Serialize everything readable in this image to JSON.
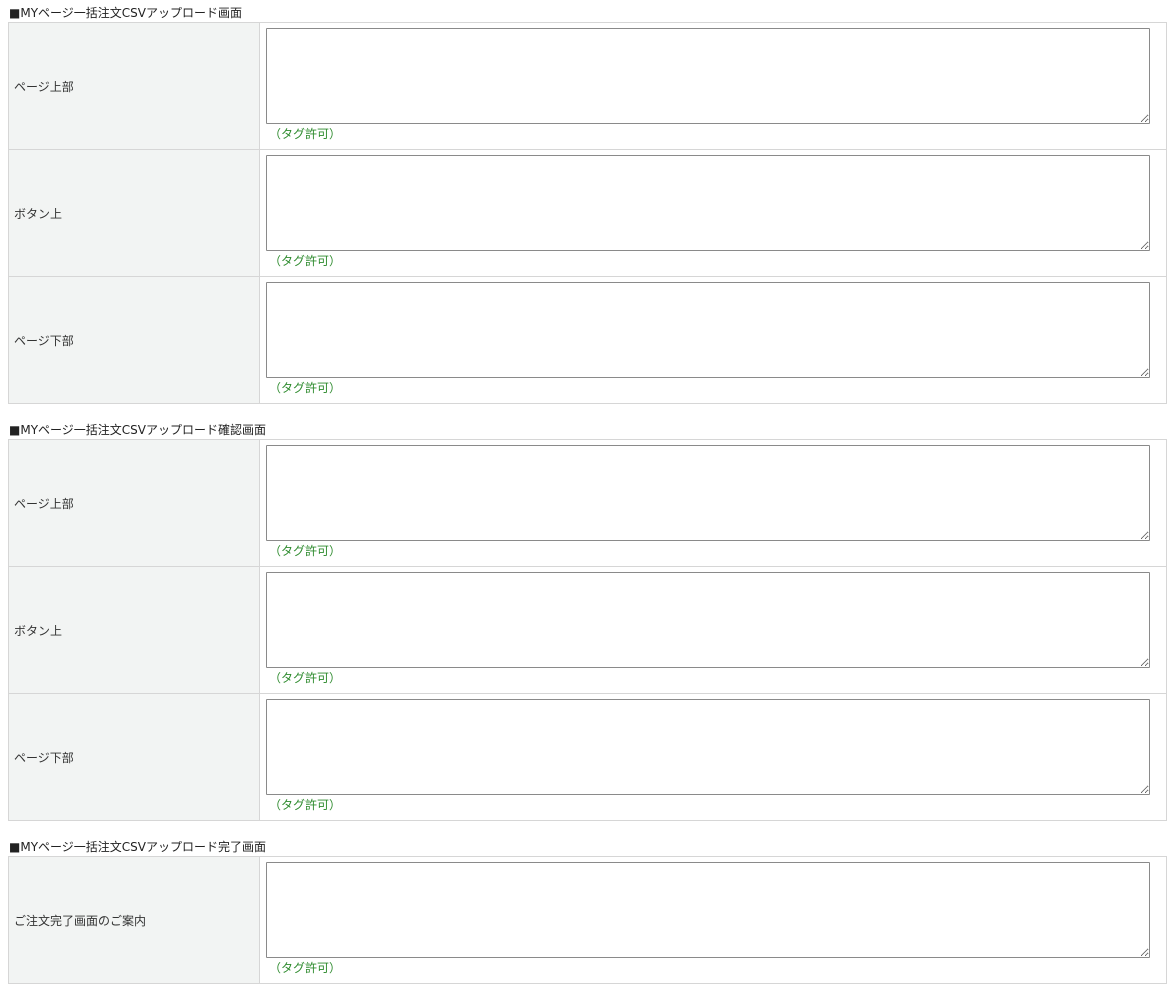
{
  "sections": [
    {
      "title": "■MYページ一括注文CSVアップロード画面",
      "rows": [
        {
          "label": "ページ上部",
          "value": "",
          "note": "（タグ許可）"
        },
        {
          "label": "ボタン上",
          "value": "",
          "note": "（タグ許可）"
        },
        {
          "label": "ページ下部",
          "value": "",
          "note": "（タグ許可）"
        }
      ]
    },
    {
      "title": "■MYページ一括注文CSVアップロード確認画面",
      "rows": [
        {
          "label": "ページ上部",
          "value": "",
          "note": "（タグ許可）"
        },
        {
          "label": "ボタン上",
          "value": "",
          "note": "（タグ許可）"
        },
        {
          "label": "ページ下部",
          "value": "",
          "note": "（タグ許可）"
        }
      ]
    },
    {
      "title": "■MYページ一括注文CSVアップロード完了画面",
      "rows": [
        {
          "label": "ご注文完了画面のご案内",
          "value": "",
          "note": "（タグ許可）"
        }
      ]
    }
  ]
}
